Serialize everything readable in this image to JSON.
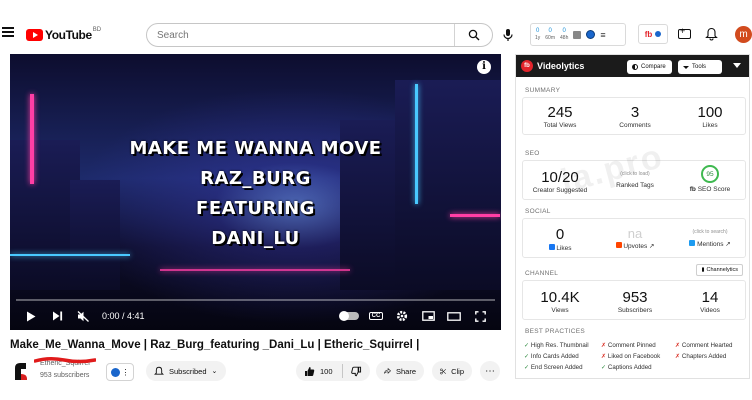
{
  "header": {
    "logo_text": "YouTube",
    "country_code": "BD",
    "search_placeholder": "Search",
    "ext_stats": [
      {
        "value": "0",
        "label": "1y"
      },
      {
        "value": "0",
        "label": "60m"
      },
      {
        "value": "0",
        "label": "48h"
      }
    ],
    "ext_menu": "≡",
    "avatar_letter": "m"
  },
  "player": {
    "lyrics": [
      "MAKE ME WANNA MOVE",
      "RAZ_BURG",
      "FEATURING",
      "DANI_LU"
    ],
    "time": "0:00 / 4:41",
    "progress_fraction": 0,
    "cc_label": "CC",
    "info_label": "i"
  },
  "video": {
    "title": "Make_Me_Wanna_Move | Raz_Burg_featuring _Dani_Lu | Etheric_Squirrel |",
    "channel_name": "Etheric_Squirrel",
    "subscribers": "953 subscribers",
    "subscribed_label": "Subscribed",
    "likes": "100",
    "share_label": "Share",
    "clip_label": "Clip",
    "more_label": "⋯"
  },
  "videolytics": {
    "brand": "Videolytics",
    "compare_label": "Compare",
    "tools_label": "Tools",
    "summary": {
      "label": "SUMMARY",
      "total_views": "245",
      "total_views_label": "Total Views",
      "comments": "3",
      "comments_label": "Comments",
      "likes": "100",
      "likes_label": "Likes"
    },
    "seo": {
      "label": "SEO",
      "creator_suggested": "10/20",
      "creator_suggested_label": "Creator Suggested",
      "ranked_hint": "(click to load)",
      "ranked_label": "Ranked Tags",
      "score": "95",
      "score_label": "SEO Score"
    },
    "social": {
      "label": "SOCIAL",
      "likes": "0",
      "likes_label": "Likes",
      "upvotes": "na",
      "upvotes_label": "Upvotes",
      "mentions_hint": "(click to search)",
      "mentions_label": "Mentions"
    },
    "channel": {
      "label": "CHANNEL",
      "button_label": "Channelytics",
      "views": "10.4K",
      "views_label": "Views",
      "subscribers": "953",
      "subscribers_label": "Subscribers",
      "videos": "14",
      "videos_label": "Videos"
    },
    "best_practices": {
      "label": "BEST PRACTICES",
      "items": [
        {
          "text": "High Res. Thumbnail",
          "mark": "✓"
        },
        {
          "text": "Comment Pinned",
          "mark": "✗"
        },
        {
          "text": "Comment Hearted",
          "mark": "✗"
        },
        {
          "text": "Info Cards Added",
          "mark": "✓"
        },
        {
          "text": "Liked on Facebook",
          "mark": "✗"
        },
        {
          "text": "Chapters Added",
          "mark": "✗"
        },
        {
          "text": "End Screen Added",
          "mark": "✓"
        },
        {
          "text": "Captions Added",
          "mark": "✓"
        }
      ]
    }
  },
  "watermark": "ia.pro",
  "colors": {
    "brand_red": "#ff0000",
    "videolytics_red": "#e3242b",
    "link_blue": "#1a66cc",
    "good_green": "#2c8a3d",
    "bad_red": "#d93025"
  }
}
